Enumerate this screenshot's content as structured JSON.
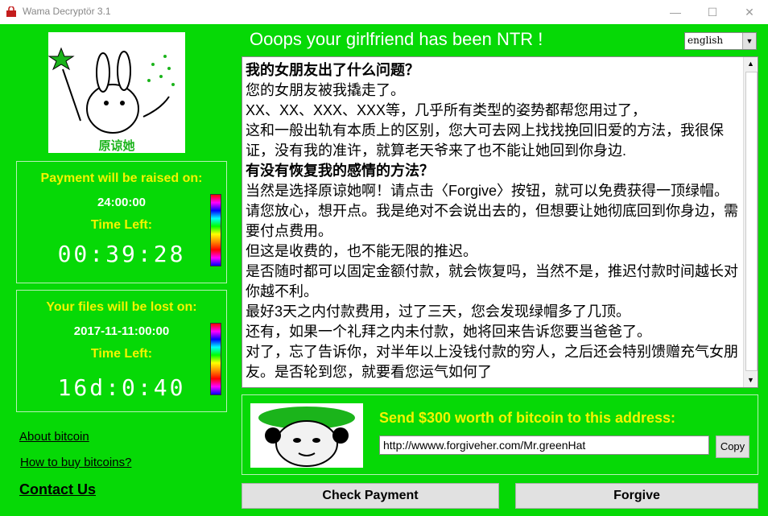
{
  "window": {
    "title": "Wama Decryptör 3.1"
  },
  "header": {
    "title": "Ooops your girlfriend has been NTR !",
    "language_selected": "english"
  },
  "logo": {
    "caption": "原谅她"
  },
  "payment_raise": {
    "label": "Payment will be raised on:",
    "value": "24:00:00",
    "time_left_label": "Time Left:",
    "timer": "00:39:28"
  },
  "files_lost": {
    "label": "Your files will be lost on:",
    "value": "2017-11-11:00:00",
    "time_left_label": "Time Left:",
    "timer": "16d:0:40"
  },
  "links": {
    "about": "About bitcoin",
    "howto": "How to buy bitcoins?",
    "contact": "Contact Us"
  },
  "message": {
    "h1": "我的女朋友出了什么问题？",
    "p1": "您的女朋友被我撬走了。",
    "p2": "XX、XX、XXX、XXX等，几乎所有类型的姿势都帮您用过了，",
    "p3": "这和一般出轨有本质上的区别，您大可去网上找找挽回旧爱的方法，我很保证，没有我的准许，就算老天爷来了也不能让她回到你身边.",
    "h2": "有没有恢复我的感情的方法？",
    "p4": "当然是选择原谅她啊！请点击〈Forgive〉按钮，就可以免费获得一顶绿帽。请您放心，想开点。我是绝对不会说出去的，但想要让她彻底回到你身边，需要付点费用。",
    "p5": "但这是收费的，也不能无限的推迟。",
    "p6": "是否随时都可以固定金额付款，就会恢复吗，当然不是，推迟付款时间越长对你越不利。",
    "p7": "最好3天之内付款费用，过了三天，您会发现绿帽多了几顶。",
    "p8": "还有，如果一个礼拜之内未付款，她将回来告诉您要当爸爸了。",
    "p9": "对了，忘了告诉你，对半年以上没钱付款的穷人，之后还会特别馈赠充气女朋友。是否轮到您，就要看您运气如何了"
  },
  "payment": {
    "instruction": "Send $300 worth of bitcoin to this address:",
    "address": "http://wwww.forgiveher.com/Mr.greenHat",
    "copy_label": "Copy"
  },
  "buttons": {
    "check": "Check Payment",
    "forgive": "Forgive"
  },
  "colors": {
    "background": "#06d906",
    "accent_yellow": "#f4f400"
  }
}
